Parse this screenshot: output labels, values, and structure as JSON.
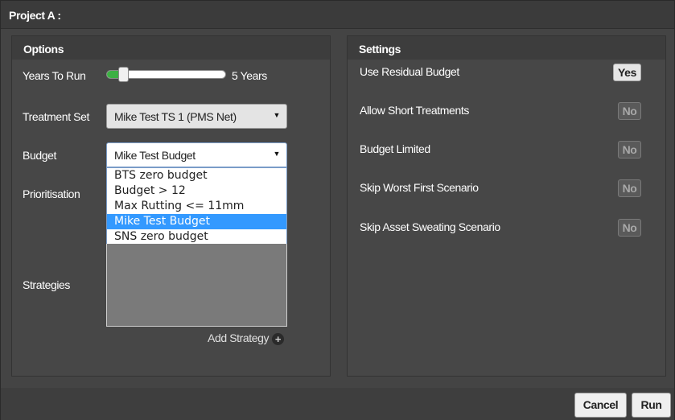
{
  "window": {
    "title": "Project A :"
  },
  "options": {
    "header": "Options",
    "years_to_run": {
      "label": "Years To Run",
      "value_text": "5 Years",
      "fill_fraction": 0.12
    },
    "treatment_set": {
      "label": "Treatment Set",
      "value": "Mike Test TS 1 (PMS Net)"
    },
    "budget": {
      "label": "Budget",
      "value": "Mike Test Budget",
      "options": [
        "BTS zero budget",
        "Budget > 12",
        "Max Rutting <= 11mm",
        "Mike Test Budget",
        "SNS zero budget"
      ],
      "selected_index": 3
    },
    "prioritisation": {
      "label": "Prioritisation"
    },
    "strategies": {
      "label": "Strategies"
    },
    "add_strategy_label": "Add Strategy"
  },
  "settings": {
    "header": "Settings",
    "items": [
      {
        "label": "Use Residual Budget",
        "toggle": "Yes"
      },
      {
        "label": "Allow Short Treatments",
        "toggle": "No"
      },
      {
        "label": "Budget Limited",
        "toggle": "No"
      },
      {
        "label": "Skip Worst First Scenario",
        "toggle": "No"
      },
      {
        "label": "Skip Asset Sweating Scenario",
        "toggle": "No"
      }
    ]
  },
  "footer": {
    "cancel_label": "Cancel",
    "run_label": "Run"
  },
  "colors": {
    "accent_green": "#3cb043",
    "selection_blue": "#3399ff"
  }
}
